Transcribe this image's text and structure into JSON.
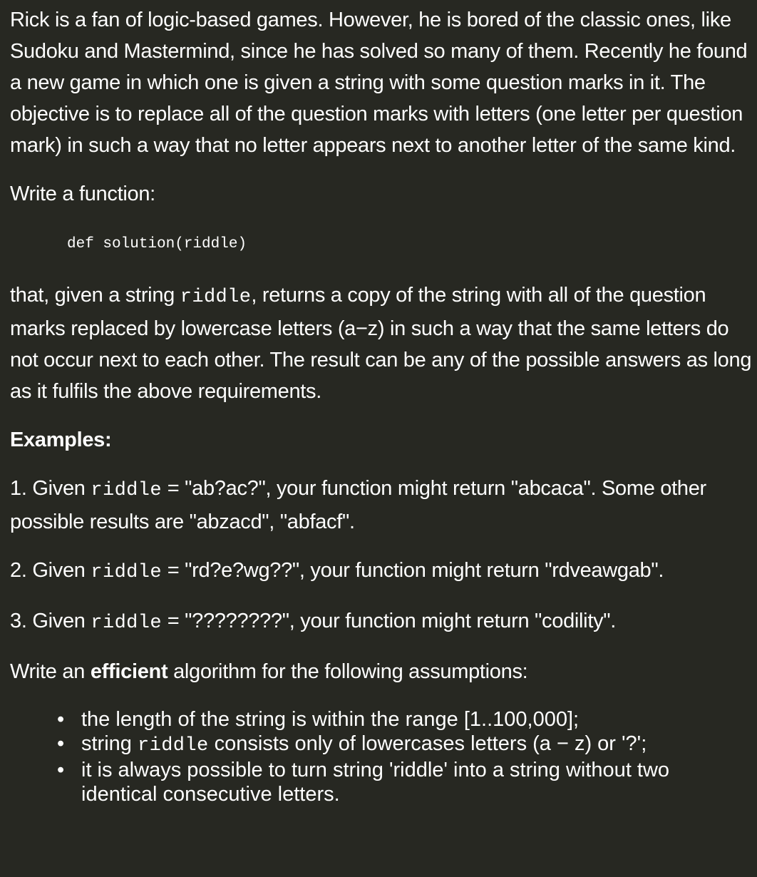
{
  "intro": "Rick is a fan of logic-based games. However, he is bored of the classic ones, like Sudoku and Mastermind, since he has solved so many of them. Recently he found a new game in which one is given a string with some question marks in it. The objective is to replace all of the question marks with letters (one letter per question mark) in such a way that no letter appears next to another letter of the same kind.",
  "write_function": "Write a function:",
  "signature": "def solution(riddle)",
  "description": {
    "part1": "that, given a string ",
    "code": "riddle",
    "part2": ", returns a copy of the string with all of the question marks replaced by lowercase letters (a−z) in such a way that the same letters do not occur next to each other. The result can be any of the possible answers as long as it fulfils the above requirements."
  },
  "examples_heading": "Examples:",
  "examples": [
    {
      "prefix": "1. Given ",
      "code": "riddle",
      "suffix": " = \"ab?ac?\", your function might return \"abcaca\". Some other possible results are \"abzacd\", \"abfacf\"."
    },
    {
      "prefix": "2. Given ",
      "code": "riddle",
      "suffix": " = \"rd?e?wg??\", your function might return \"rdveawgab\"."
    },
    {
      "prefix": "3. Given ",
      "code": "riddle",
      "suffix": " = \"????????\", your function might return \"codility\"."
    }
  ],
  "efficient": {
    "pre": "Write an ",
    "bold": "efficient",
    "post": " algorithm for the following assumptions:"
  },
  "assumptions": [
    {
      "pre": "the length of the string is within the range [1..100,000];"
    },
    {
      "pre": "string ",
      "code": "riddle",
      "post": " consists only of lowercases letters (a − z) or '?';"
    },
    {
      "pre": "it is always possible to turn string 'riddle' into a string without two identical consecutive letters."
    }
  ],
  "bullet_char": "•"
}
